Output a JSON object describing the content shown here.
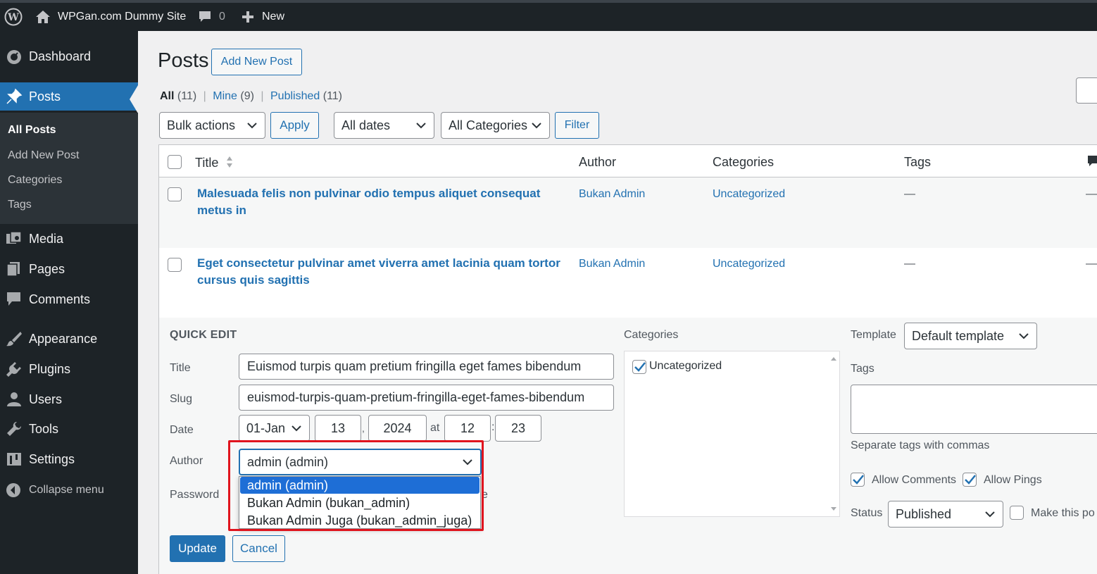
{
  "adminbar": {
    "site_name": "WPGan.com Dummy Site",
    "comments_count": "0",
    "new_label": "New"
  },
  "sidebar": {
    "items": [
      {
        "label": "Dashboard",
        "icon": "dashboard-icon"
      },
      {
        "label": "Posts",
        "icon": "pin-icon"
      },
      {
        "label": "Media",
        "icon": "media-icon"
      },
      {
        "label": "Pages",
        "icon": "pages-icon"
      },
      {
        "label": "Comments",
        "icon": "comments-icon"
      },
      {
        "label": "Appearance",
        "icon": "brush-icon"
      },
      {
        "label": "Plugins",
        "icon": "plug-icon"
      },
      {
        "label": "Users",
        "icon": "user-icon"
      },
      {
        "label": "Tools",
        "icon": "wrench-icon"
      },
      {
        "label": "Settings",
        "icon": "settings-icon"
      },
      {
        "label": "Collapse menu",
        "icon": "collapse-icon"
      }
    ],
    "submenu": [
      "All Posts",
      "Add New Post",
      "Categories",
      "Tags"
    ]
  },
  "page": {
    "title": "Posts",
    "add_new_label": "Add New Post"
  },
  "filters": {
    "all_label": "All",
    "all_count": "(11)",
    "mine_label": "Mine",
    "mine_count": "(9)",
    "published_label": "Published",
    "published_count": "(11)",
    "sep": "|"
  },
  "toolbar": {
    "bulk_actions": "Bulk actions",
    "apply": "Apply",
    "all_dates": "All dates",
    "all_categories": "All Categories",
    "filter": "Filter"
  },
  "table": {
    "columns": [
      "Title",
      "Author",
      "Categories",
      "Tags"
    ],
    "rows": [
      {
        "title_line1": "Malesuada felis non pulvinar odio tempus aliquet consequat",
        "title_line2": "metus in",
        "author": "Bukan Admin",
        "category": "Uncategorized",
        "tags": "—",
        "extra": "—"
      },
      {
        "title_line1": "Eget consectetur pulvinar amet viverra amet lacinia quam tortor",
        "title_line2": "cursus quis sagittis",
        "author": "Bukan Admin",
        "category": "Uncategorized",
        "tags": "—",
        "extra": "—"
      }
    ]
  },
  "quick_edit": {
    "heading": "QUICK EDIT",
    "title_label": "Title",
    "title_value": "Euismod turpis quam pretium fringilla eget fames bibendum",
    "slug_label": "Slug",
    "slug_value": "euismod-turpis-quam-pretium-fringilla-eget-fames-bibendum",
    "date_label": "Date",
    "month": "01-Jan",
    "day": "13",
    "comma": ",",
    "year": "2024",
    "at": "at",
    "hour": "12",
    "colon": ":",
    "minute": "23",
    "author_label": "Author",
    "author_value": "admin (admin)",
    "author_options": [
      "admin (admin)",
      "Bukan Admin (bukan_admin)",
      "Bukan Admin Juga (bukan_admin_juga)"
    ],
    "password_label": "Password",
    "password_trail": "e",
    "categories_label": "Categories",
    "category_item": "Uncategorized",
    "template_label": "Template",
    "template_value": "Default template",
    "tags_label": "Tags",
    "tags_hint": "Separate tags with commas",
    "allow_comments": "Allow Comments",
    "allow_pings": "Allow Pings",
    "status_label": "Status",
    "status_value": "Published",
    "sticky_label": "Make this po",
    "update": "Update",
    "cancel": "Cancel"
  },
  "colors": {
    "highlight_box": "#e0141e",
    "accent": "#2271b1",
    "adminbar": "#1d2327"
  }
}
